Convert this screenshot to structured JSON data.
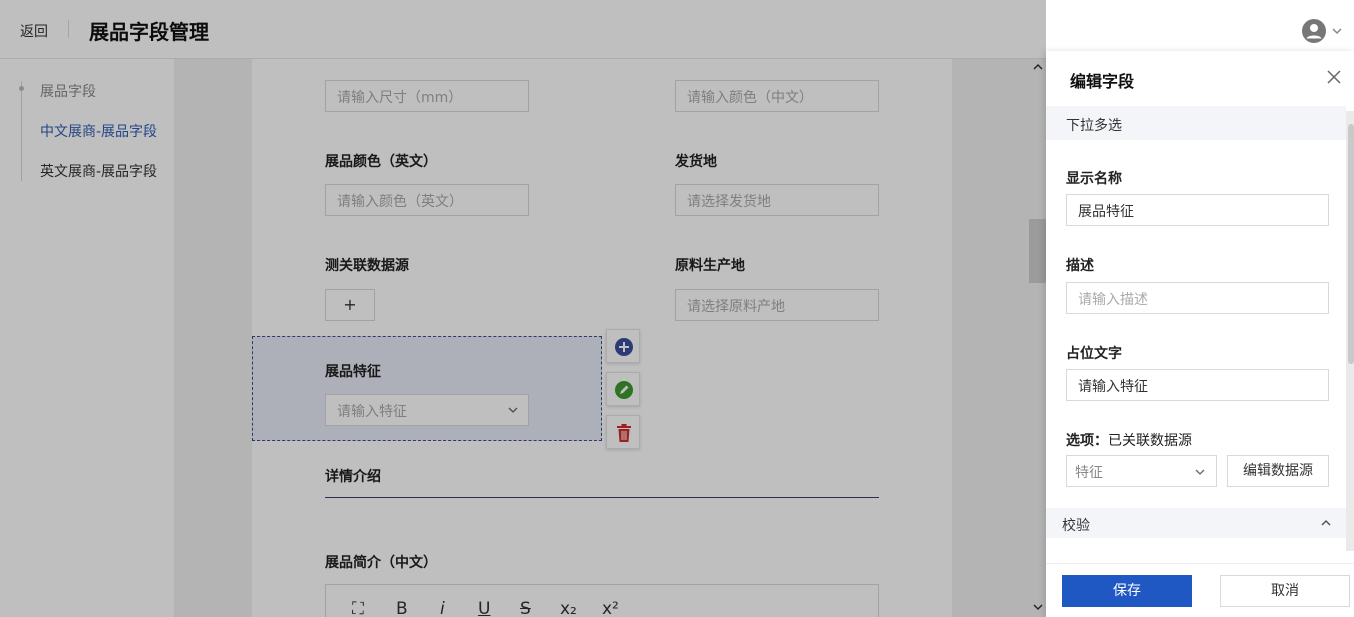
{
  "header": {
    "back_label": "返回",
    "title": "展品字段管理"
  },
  "sidenav": {
    "items": [
      {
        "label": "展品字段"
      },
      {
        "label": "中文展商-展品字段"
      },
      {
        "label": "英文展商-展品字段"
      }
    ]
  },
  "form": {
    "size_placeholder": "请输入尺寸（mm）",
    "color_cn_placeholder": "请输入颜色（中文）",
    "color_en_label": "展品颜色（英文）",
    "color_en_placeholder": "请输入颜色（英文）",
    "ship_label": "发货地",
    "ship_placeholder": "请选择发货地",
    "datasource_label": "测关联数据源",
    "add_symbol": "+",
    "origin_label": "原料生产地",
    "origin_placeholder": "请选择原料产地",
    "feature_label": "展品特征",
    "feature_placeholder": "请输入特征",
    "detail_section": "详情介绍",
    "intro_cn_label": "展品简介（中文）",
    "toolbar": {
      "fullscreen": "⛶",
      "bold": "B",
      "italic": "i",
      "underline": "U",
      "strike": "S",
      "subscript": "x₂",
      "superscript": "x²"
    }
  },
  "drawer": {
    "title": "编辑字段",
    "field_type": "下拉多选",
    "display_name_label": "显示名称",
    "display_name_value": "展品特征",
    "description_label": "描述",
    "description_placeholder": "请输入描述",
    "placeholder_label": "占位文字",
    "placeholder_value": "请输入特征",
    "options_label_strong": "选项：",
    "options_label_rest": "已关联数据源",
    "options_select_value": "特征",
    "edit_datasource_label": "编辑数据源",
    "validate_label": "校验",
    "save_label": "保存",
    "cancel_label": "取消"
  },
  "colors": {
    "accent": "#1f57c3",
    "active_nav": "#2f5db3",
    "add_icon": "#3a4f9c",
    "edit_icon": "#3c9a2e",
    "delete_icon": "#d42a2a"
  }
}
